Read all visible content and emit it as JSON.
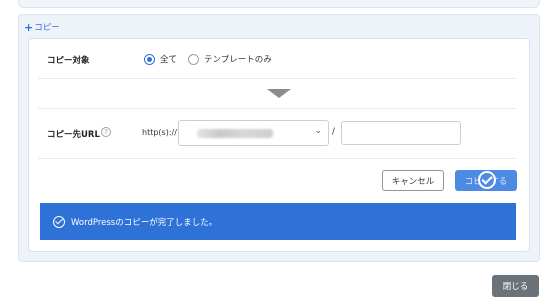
{
  "section": {
    "toggle_symbol": "+",
    "title": "コピー"
  },
  "copy_target": {
    "label": "コピー対象",
    "options": [
      {
        "label": "全て",
        "checked": true
      },
      {
        "label": "テンプレートのみ",
        "checked": false
      }
    ]
  },
  "copy_destination": {
    "label": "コピー先URL",
    "help_symbol": "?",
    "url_prefix": "http(s)://",
    "separator": "/",
    "path_value": ""
  },
  "buttons": {
    "cancel": "キャンセル",
    "copy": "コピーする",
    "close": "閉じる"
  },
  "banner": {
    "message": "WordPressのコピーが完了しました。"
  },
  "colors": {
    "accent": "#2e72d8",
    "close_button": "#6c7279",
    "panel_bg": "#eef3fa"
  }
}
